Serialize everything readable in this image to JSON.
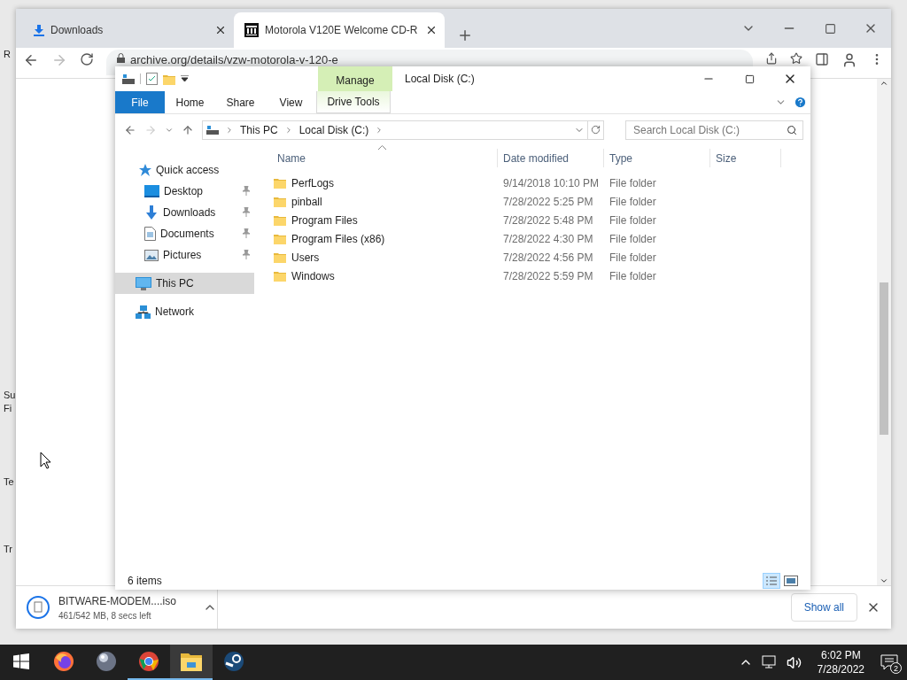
{
  "desktop": {
    "fragments": [
      "R",
      "Su",
      "Fi",
      "Te",
      "Tr"
    ]
  },
  "browser": {
    "tabs": [
      {
        "label": "Downloads",
        "kind": "download",
        "selected": false
      },
      {
        "label": "Motorola V120E Welcome CD-R",
        "kind": "archive",
        "selected": true
      }
    ],
    "url": "archive.org/details/vzw-motorola-v-120-e",
    "download": {
      "filename": "BITWARE-MODEM....iso",
      "status": "461/542 MB, 8 secs left"
    },
    "show_all": "Show all"
  },
  "explorer": {
    "context_tab": "Manage",
    "title": "Local Disk (C:)",
    "ribbon_tabs": [
      {
        "label": "File",
        "kind": "file"
      },
      {
        "label": "Home",
        "kind": "plain"
      },
      {
        "label": "Share",
        "kind": "plain"
      },
      {
        "label": "View",
        "kind": "plain"
      },
      {
        "label": "Drive Tools",
        "kind": "context"
      }
    ],
    "breadcrumb": [
      "This PC",
      "Local Disk (C:)"
    ],
    "search": {
      "placeholder": "Search Local Disk (C:)"
    },
    "nav": [
      {
        "label": "Quick access",
        "kind": "star",
        "selected": false,
        "children": [
          {
            "label": "Desktop",
            "kind": "desktop",
            "selected": false,
            "pinned": true
          },
          {
            "label": "Downloads",
            "kind": "download",
            "selected": false,
            "pinned": true
          },
          {
            "label": "Documents",
            "kind": "document",
            "selected": false,
            "pinned": true
          },
          {
            "label": "Pictures",
            "kind": "pictures",
            "selected": false,
            "pinned": true
          }
        ]
      },
      {
        "label": "This PC",
        "kind": "pc",
        "selected": true
      },
      {
        "label": "Network",
        "kind": "network",
        "selected": false
      }
    ],
    "columns": [
      "Name",
      "Date modified",
      "Type",
      "Size"
    ],
    "rows": [
      {
        "name": "PerfLogs",
        "date": "9/14/2018 10:10 PM",
        "type": "File folder"
      },
      {
        "name": "pinball",
        "date": "7/28/2022 5:25 PM",
        "type": "File folder"
      },
      {
        "name": "Program Files",
        "date": "7/28/2022 5:48 PM",
        "type": "File folder"
      },
      {
        "name": "Program Files (x86)",
        "date": "7/28/2022 4:30 PM",
        "type": "File folder"
      },
      {
        "name": "Users",
        "date": "7/28/2022 4:56 PM",
        "type": "File folder"
      },
      {
        "name": "Windows",
        "date": "7/28/2022 5:59 PM",
        "type": "File folder"
      }
    ],
    "status": "6 items"
  },
  "taskbar": {
    "apps": [
      {
        "kind": "firefox",
        "running": false,
        "focused": false
      },
      {
        "kind": "sphere",
        "running": false,
        "focused": false
      },
      {
        "kind": "chrome",
        "running": true,
        "focused": false
      },
      {
        "kind": "explorer",
        "running": true,
        "focused": true
      },
      {
        "kind": "steam",
        "running": false,
        "focused": false
      }
    ],
    "time": "6:02 PM",
    "date": "7/28/2022",
    "notifications": "2"
  }
}
